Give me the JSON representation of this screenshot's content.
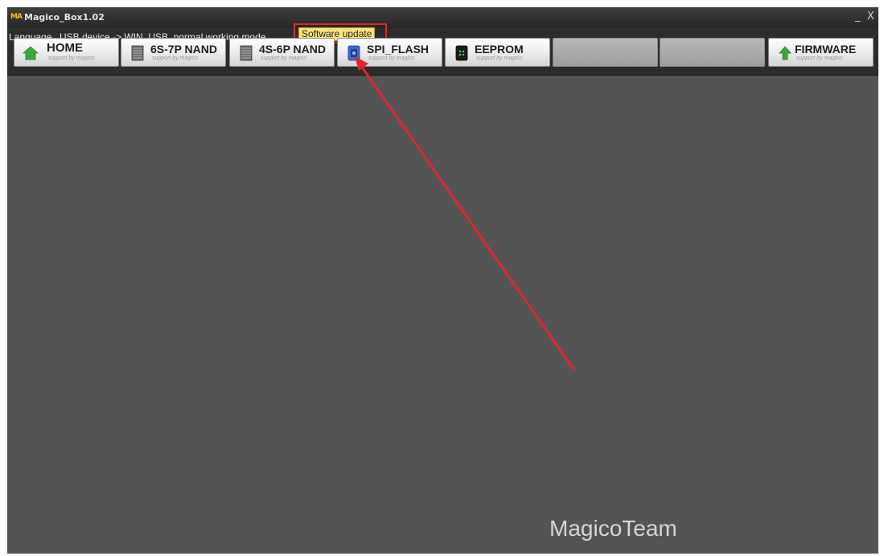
{
  "window": {
    "title": "Magico_Box1.02",
    "logo_text": "MA",
    "minimize": "_",
    "close": "X"
  },
  "menubar": {
    "language": "Language",
    "status": "USB device -> WIN_USB, normal working mode...",
    "tooltip": "Software update"
  },
  "toolbar": {
    "buttons": [
      {
        "label": "HOME",
        "sub": "support by magico",
        "icon": "home-icon"
      },
      {
        "label": "6S-7P NAND",
        "sub": "support by magico",
        "icon": "chip-icon"
      },
      {
        "label": "4S-6P NAND",
        "sub": "support by magico",
        "icon": "chip-icon"
      },
      {
        "label": "SPI_FLASH",
        "sub": "support by magico",
        "icon": "flash-chip-icon"
      },
      {
        "label": "EEPROM",
        "sub": "support by magico",
        "icon": "eeprom-icon"
      },
      {
        "label": "",
        "sub": "",
        "icon": ""
      },
      {
        "label": "",
        "sub": "",
        "icon": ""
      },
      {
        "label": "FIRMWARE",
        "sub": "support by magico",
        "icon": "upload-arrow-icon"
      }
    ]
  },
  "watermark": "MagicoTeam",
  "colors": {
    "accent_red": "#e0262b",
    "home_green": "#3aa83a",
    "tooltip_bg": "#ffe37a"
  }
}
